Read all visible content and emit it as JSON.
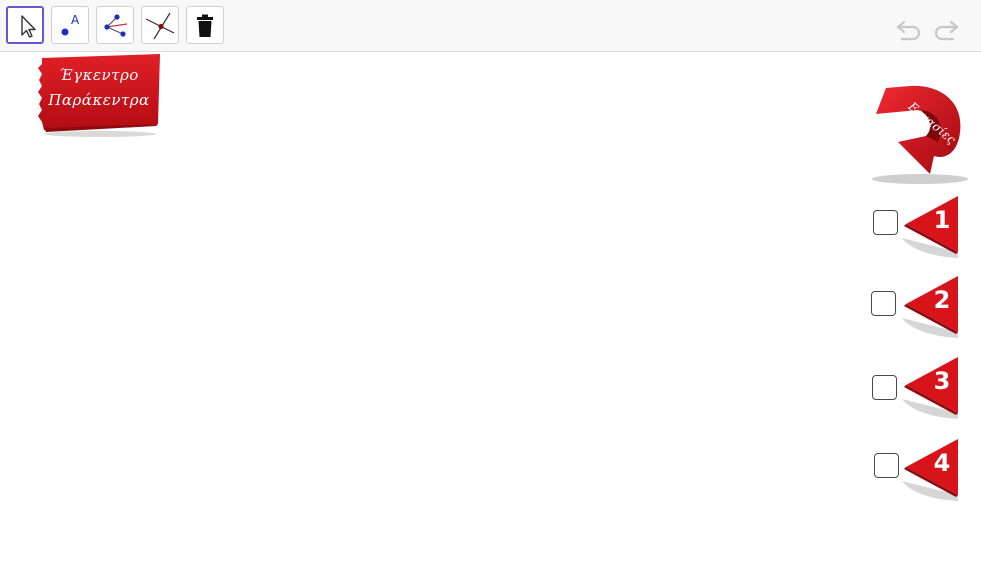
{
  "toolbar": {
    "tools": [
      {
        "name": "move-tool",
        "icon": "cursor-arrow-icon",
        "selected": true
      },
      {
        "name": "point-tool",
        "icon": "point-a-icon",
        "selected": false
      },
      {
        "name": "segment-tool",
        "icon": "segment-icon",
        "selected": false
      },
      {
        "name": "intersect-tool",
        "icon": "intersect-icon",
        "selected": false
      },
      {
        "name": "delete-tool",
        "icon": "trash-icon",
        "selected": false
      }
    ],
    "undo_icon": "undo-icon",
    "redo_icon": "redo-icon"
  },
  "title_card": {
    "line1": "Έγκεντρο",
    "line2": "Παράκεντρα"
  },
  "tasks": {
    "badge_label": "Εργασίες",
    "items": [
      {
        "number": "1",
        "checked": false
      },
      {
        "number": "2",
        "checked": false
      },
      {
        "number": "3",
        "checked": false
      },
      {
        "number": "4",
        "checked": false
      }
    ]
  },
  "colors": {
    "accent_red": "#d8141b",
    "dark_red": "#8e0a0f",
    "tool_selected": "#6557d2",
    "point_blue": "#1a2fbd"
  }
}
